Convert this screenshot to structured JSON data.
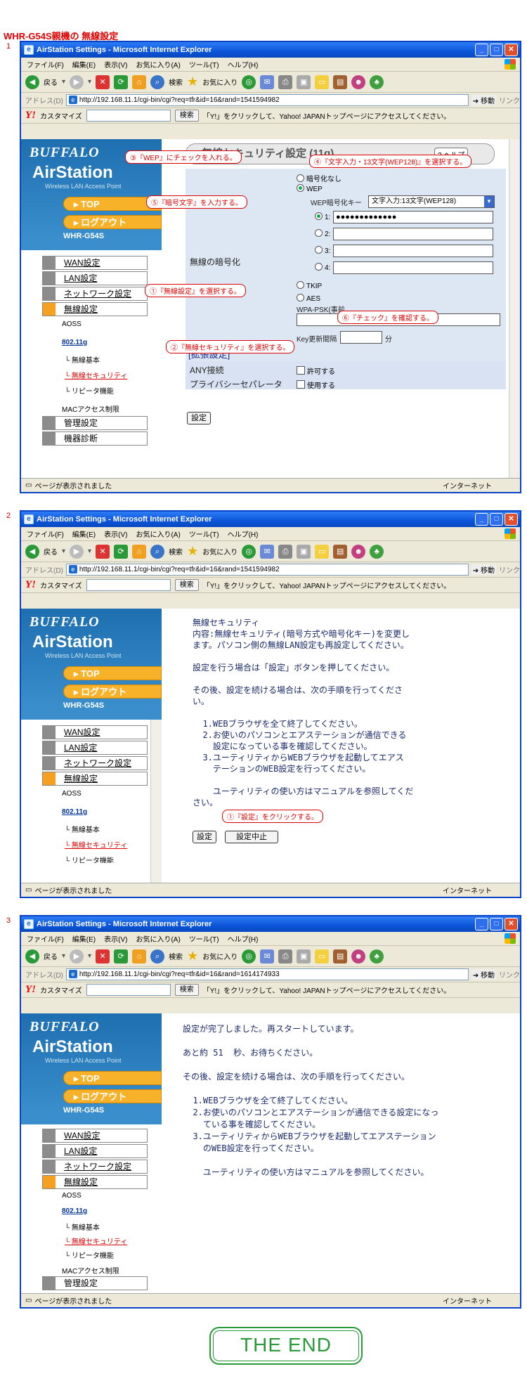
{
  "heading": "WHR-G54S親機の 無線設定",
  "steps": [
    "1",
    "2",
    "3"
  ],
  "browser": {
    "title": "AirStation Settings - Microsoft Internet Explorer",
    "menu": [
      "ファイル(F)",
      "編集(E)",
      "表示(V)",
      "お気に入り(A)",
      "ツール(T)",
      "ヘルプ(H)"
    ],
    "back": "戻る",
    "search": "検索",
    "favorites": "お気に入り",
    "address_label": "アドレス(D)",
    "go": "移動",
    "links": "リンク",
    "customize": "カスタマイズ",
    "search_btn": "検索",
    "yahoo_text": "「Y!」をクリックして、Yahoo! JAPANトップページにアクセスしてください。",
    "status": "ページが表示されました",
    "zone": "インターネット"
  },
  "urls": [
    "http://192.168.11.1/cgi-bin/cgi?req=tfr&id=16&rand=1541594982",
    "http://192.168.11.1/cgi-bin/cgi?req=tfr&id=16&rand=1541594982",
    "http://192.168.11.1/cgi-bin/cgi?req=tfr&id=16&rand=1614174933"
  ],
  "sidebar": {
    "brand": "BUFFALO",
    "product": "AirStation",
    "tagline": "Wireless LAN Access Point",
    "top": "TOP",
    "logout": "ログアウト",
    "model": "WHR-G54S",
    "items": [
      "WAN設定",
      "LAN設定",
      "ネットワーク設定",
      "無線設定"
    ],
    "sub": [
      "AOSS",
      "802.11g",
      "無線基本",
      "無線セキュリティ",
      "リピータ機能",
      "MACアクセス制限"
    ],
    "items2": [
      "管理設定",
      "機器診断"
    ]
  },
  "screen1": {
    "panel_title": "無線セキュリティ設定 (11g)",
    "help": "ヘルプ",
    "enc_label": "無線の暗号化",
    "opt_none": "暗号化なし",
    "opt_wep": "WEP",
    "wep_key_label": "WEP暗号化キー",
    "wep_key_select": "文字入力:13文字(WEP128)",
    "key_nums": [
      "1:",
      "2:",
      "3:",
      "4:"
    ],
    "key1_value": "●●●●●●●●●●●●●",
    "opt_tkip": "TKIP",
    "opt_aes": "AES",
    "wpa_psk": "WPA-PSK(事前",
    "key_interval": "Key更新間隔",
    "minutes": "分",
    "ext_title": "[拡張設定]",
    "any_label": "ANY接続",
    "any_val": "許可する",
    "priv_label": "プライバシーセパレータ",
    "priv_val": "使用する",
    "submit": "設定",
    "callouts": [
      "③『WEP』にチェックを入れる。",
      "④『文字入力・13文字(WEP128)』を選択する。",
      "⑤『暗号文字』を入力する。",
      "①『無線設定』を選択する。",
      "⑥『チェック』を確認する。",
      "②『無線セキュリティ』を選択する。"
    ]
  },
  "screen2": {
    "text": "無線セキュリティ\n内容:無線セキュリティ(暗号方式や暗号化キー)を変更し\nます。パソコン側の無線LAN設定も再設定してください。\n\n設定を行う場合は「設定」ボタンを押してください。\n\nその後、設定を続ける場合は、次の手順を行ってくださ\nい。\n\n  1.WEBブラウザを全て終了してください。\n  2.お使いのパソコンとエアステーションが通信できる\n    設定になっている事を確認してください。\n  3.ユーティリティからWEBブラウザを起動してエアス\n    テーションのWEB設定を行ってください。\n\n    ユーティリティの使い方はマニュアルを参照してくだ\nさい。",
    "callout": "①『設定』をクリックする。",
    "submit": "設定",
    "cancel": "設定中止"
  },
  "screen3": {
    "text": "設定が完了しました。再スタートしています。\n\nあと約 51  秒、お待ちください。\n\nその後、設定を続ける場合は、次の手順を行ってください。\n\n  1.WEBブラウザを全て終了してください。\n  2.お使いのパソコンとエアステーションが通信できる設定になっ\n    ている事を確認してください。\n  3.ユーティリティからWEBブラウザを起動してエアステーション\n    のWEB設定を行ってください。\n\n    ユーティリティの使い方はマニュアルを参照してください。"
  },
  "the_end": "THE END"
}
